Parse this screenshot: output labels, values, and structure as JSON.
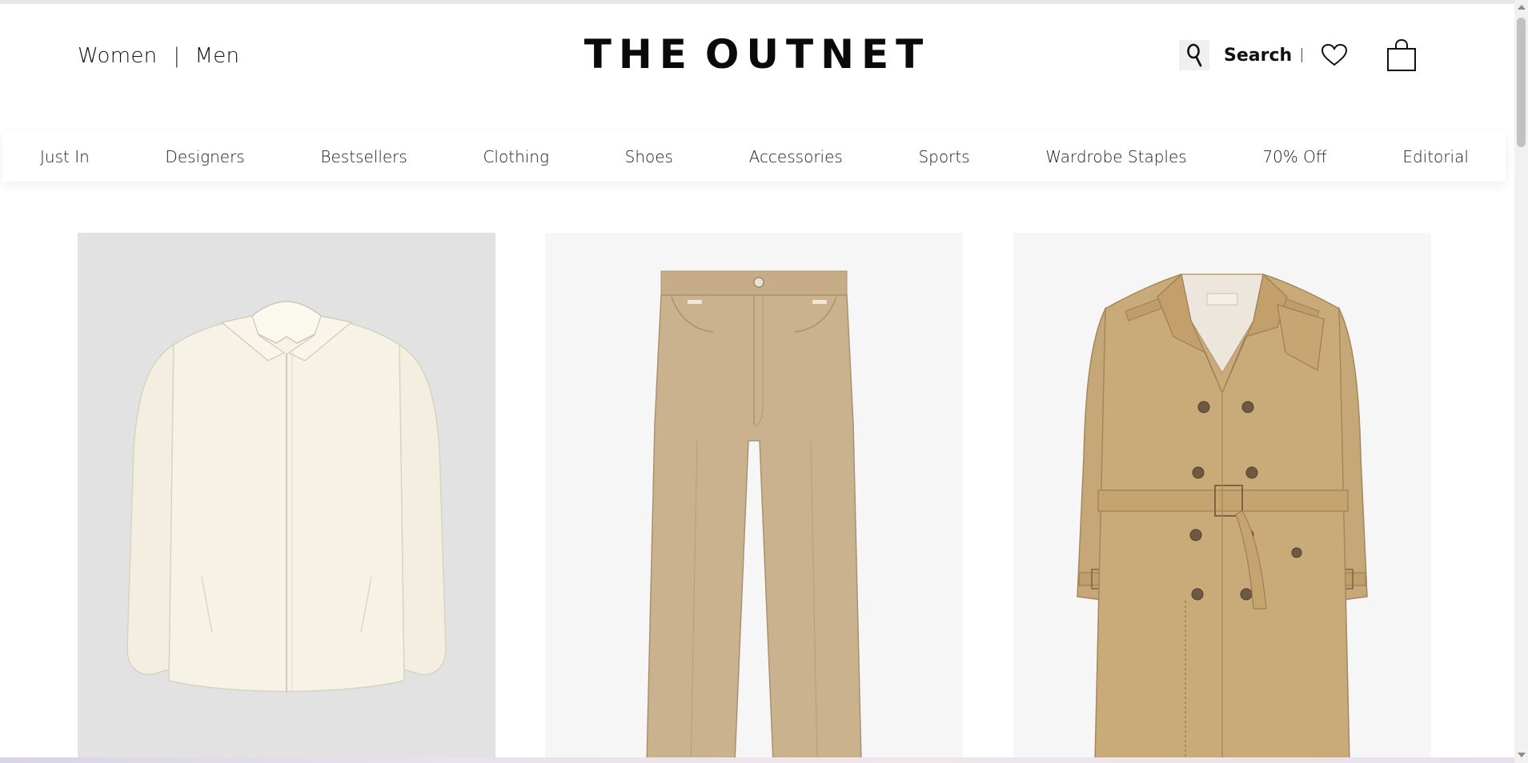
{
  "header": {
    "gender_links": [
      "Women",
      "Men"
    ],
    "separator": "|",
    "logo_text": "THE OUTNET",
    "logo_words": [
      "THE",
      "OUTNET"
    ],
    "search_label": "Search",
    "search_separator": "|",
    "icons": [
      "search-icon",
      "heart-icon",
      "shopping-bag-icon"
    ]
  },
  "nav": {
    "items": [
      "Just In",
      "Designers",
      "Bestsellers",
      "Clothing",
      "Shoes",
      "Accessories",
      "Sports",
      "Wardrobe Staples",
      "70% Off",
      "Editorial"
    ]
  },
  "products": [
    {
      "image": "cream-zip-jacket",
      "background": "#e2e2e2",
      "color": "#f5f0e2"
    },
    {
      "image": "beige-straight-leg-trousers",
      "background": "#f6f6f6",
      "color": "#c9b08c"
    },
    {
      "image": "beige-double-breasted-trench-coat",
      "background": "#f6f6f6",
      "color": "#c8a878"
    }
  ],
  "colors": {
    "text": "#111111",
    "background": "#ffffff",
    "nav_shadow": "rgba(0,0,0,0.07)"
  }
}
